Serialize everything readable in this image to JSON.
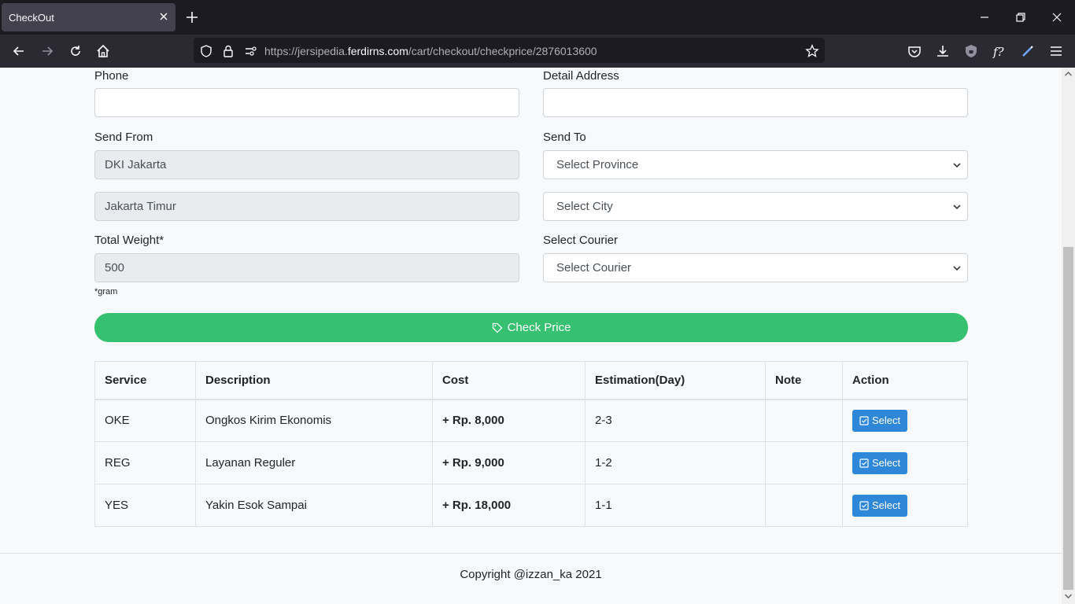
{
  "browser": {
    "tab_title": "CheckOut",
    "url_prefix": "https://jersipedia.",
    "url_domain": "ferdirns.com",
    "url_path": "/cart/checkout/checkprice/2876013600"
  },
  "form": {
    "phone_label": "Phone",
    "phone_value": "",
    "address_label": "Detail Address",
    "address_value": "",
    "send_from_label": "Send From",
    "send_from_province": "DKI Jakarta",
    "send_from_city": "Jakarta Timur",
    "send_to_label": "Send To",
    "province_select": "Select Province",
    "city_select": "Select City",
    "weight_label": "Total Weight*",
    "weight_value": "500",
    "weight_note": "*gram",
    "courier_label": "Select Courier",
    "courier_select": "Select Courier",
    "check_price_label": "Check Price"
  },
  "table": {
    "headers": [
      "Service",
      "Description",
      "Cost",
      "Estimation(Day)",
      "Note",
      "Action"
    ],
    "rows": [
      {
        "service": "OKE",
        "description": "Ongkos Kirim Ekonomis",
        "cost": "+ Rp. 8,000",
        "estimation": "2-3",
        "note": "",
        "action": "Select"
      },
      {
        "service": "REG",
        "description": "Layanan Reguler",
        "cost": "+ Rp. 9,000",
        "estimation": "1-2",
        "note": "",
        "action": "Select"
      },
      {
        "service": "YES",
        "description": "Yakin Esok Sampai",
        "cost": "+ Rp. 18,000",
        "estimation": "1-1",
        "note": "",
        "action": "Select"
      }
    ]
  },
  "footer": {
    "copyright": "Copyright @izzan_ka 2021"
  },
  "colors": {
    "check_button": "#36c171",
    "select_button": "#2f87d9"
  }
}
